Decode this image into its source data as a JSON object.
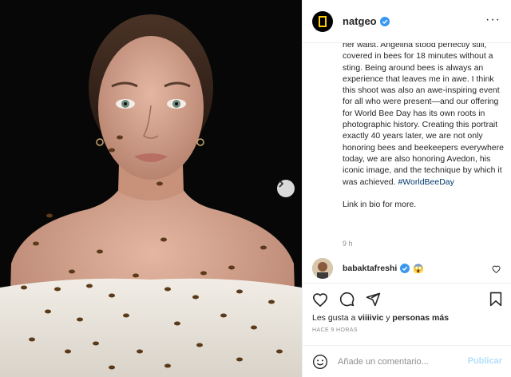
{
  "post": {
    "username": "natgeo",
    "caption_paragraphs": [
      "her waist. Angelina stood perfectly still, covered in bees for 18 minutes without a sting. Being around bees is always an experience that leaves me in awe. I think this shoot was also an awe-inspiring event for all who were present—and our offering for World Bee Day has its own roots in photographic history. Creating this portrait exactly 40 years later, we are not only honoring bees and beekeepers everywhere today, we are also honoring Avedon, his iconic image, and the technique by which it was achieved.",
      "Link in bio for more."
    ],
    "hashtag": "#WorldBeeDay",
    "caption_time": "9 h"
  },
  "comment": {
    "username": "babaktafreshi",
    "emoji": "😱"
  },
  "likes": {
    "prefix": "Les gusta a",
    "user": "viiiivic",
    "connector": "y",
    "others": "personas más"
  },
  "timestamp": "HACE 9 HORAS",
  "add_comment": {
    "placeholder": "Añade un comentario...",
    "post_label": "Publicar"
  },
  "icons": {
    "brand": "nat-geo-yellow-frame",
    "verified": "verified-badge",
    "actions": [
      "heart-icon",
      "comment-icon",
      "share-icon",
      "bookmark-icon"
    ],
    "accent": "#0095f6",
    "brand_yellow": "#ffce00"
  }
}
